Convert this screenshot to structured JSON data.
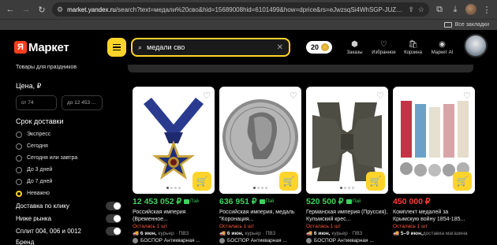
{
  "browser": {
    "url_prefix": "market.yandex.ru",
    "url_rest": "/search?text=медали%20сво&hid=15689008hid=6101499&how=dprice&rs=eJwzsqSi4WhSGP-JUZqDQWDNVYjBgUgV-H3SI9MGmDi...",
    "bookmarks_label": "Все закладки"
  },
  "header": {
    "logo_ya": "Я",
    "logo_text": "Маркет",
    "search_query": "медали сво",
    "coins": "20",
    "nav": [
      {
        "label": "Заказы",
        "icon": "orders-icon"
      },
      {
        "label": "Избранное",
        "icon": "favorites-icon"
      },
      {
        "label": "Корзина",
        "icon": "cart-icon"
      },
      {
        "label": "Маркет AI",
        "icon": "ai-icon"
      }
    ]
  },
  "subheader": "Товары для праздников",
  "sidebar": {
    "price_title": "Цена, ₽",
    "price_from": "от 74",
    "price_to": "до 12 453 ...",
    "delivery_title": "Срок доставки",
    "delivery_options": [
      {
        "label": "Экспресс",
        "selected": false
      },
      {
        "label": "Сегодня",
        "selected": false
      },
      {
        "label": "Сегодня или завтра",
        "selected": false
      },
      {
        "label": "До 3 дней",
        "selected": false
      },
      {
        "label": "До 7 дней",
        "selected": false
      },
      {
        "label": "Неважно",
        "selected": true
      }
    ],
    "toggles": [
      {
        "label": "Доставка по клику",
        "on": false
      },
      {
        "label": "Ниже рынка",
        "on": false
      },
      {
        "label": "Сплит 004, 006 и 0012",
        "on": false
      }
    ],
    "brand_title": "Бренд"
  },
  "products": [
    {
      "price": "12 453 052 ₽",
      "pay_label": "Пэй",
      "price_color": "green",
      "title": "Российская империя (Временное...",
      "stock": "Осталась 1 шт",
      "delivery_day": "6 июн,",
      "delivery_type": " курьер · ПВЗ",
      "seller": "БОСПОР Антикварная ...",
      "image": "order-star-medal"
    },
    {
      "price": "636 951 ₽",
      "pay_label": "Пэй",
      "price_color": "green",
      "title": "Российская империя, медаль \"Коронация...",
      "stock": "Осталась 1 шт",
      "delivery_day": "6 июн,",
      "delivery_type": " курьер · ПВЗ",
      "seller": "БОСПОР Антикварная ...",
      "image": "silver-coin-medal"
    },
    {
      "price": "520 500 ₽",
      "pay_label": "Пэй",
      "price_color": "green",
      "title": "Германская империя (Пруссия), Кульмский крес...",
      "stock": "Осталась 1 шт",
      "delivery_day": "6 июн,",
      "delivery_type": " курьер · ПВЗ",
      "seller": "БОСПОР Антикварная ...",
      "image": "iron-cross"
    },
    {
      "price": "450 000 ₽",
      "pay_label": "",
      "price_color": "red",
      "title": "Комплект медалей за Крымскую войну 1854-185...",
      "stock": "Осталась 1 шт",
      "delivery_day": "5–9 июн,",
      "delivery_type": "",
      "delivery_extra": "доставка магазина",
      "seller": "",
      "image": "medal-set"
    }
  ],
  "colors": {
    "accent_yellow": "#fed42b",
    "price_green": "#3cd45c",
    "price_red": "#ff3b30",
    "logo_red": "#fc3f1d"
  }
}
